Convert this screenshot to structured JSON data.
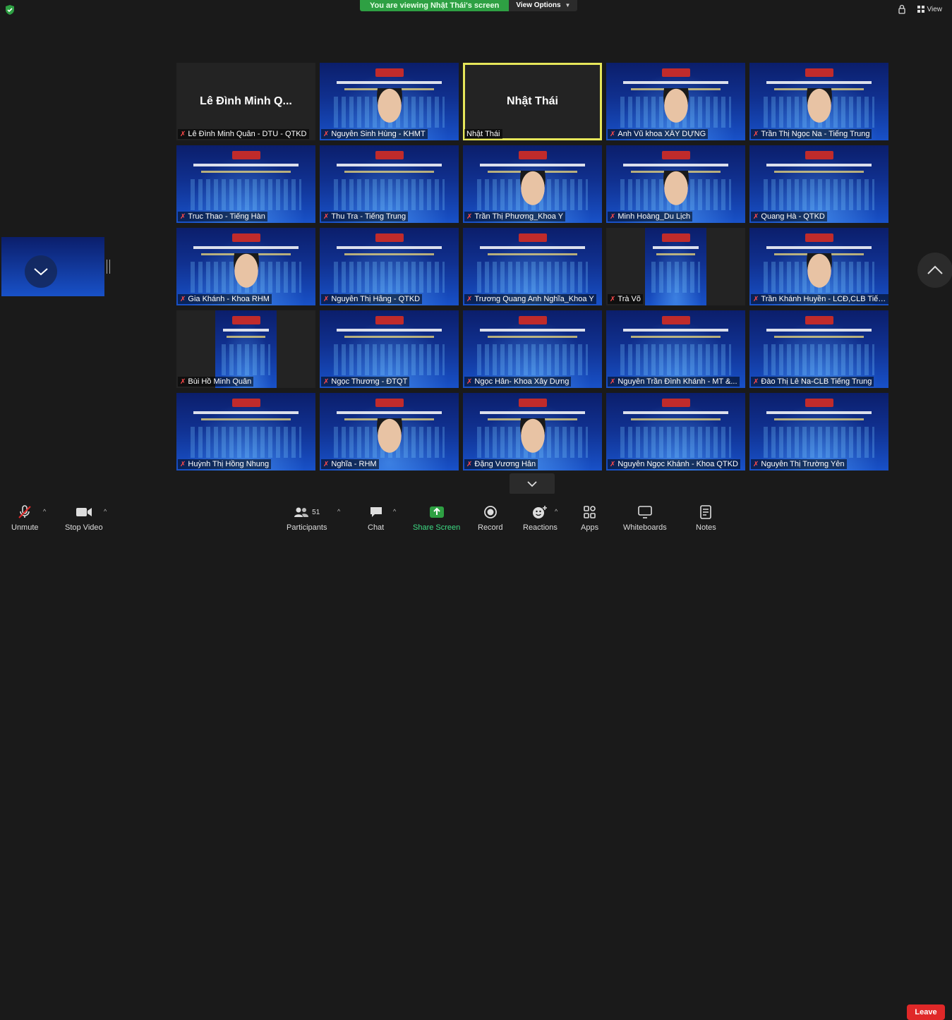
{
  "banner": {
    "viewing_text": "You are viewing Nhật Thái's screen",
    "view_options": "View Options"
  },
  "top_right": {
    "view_label": "View"
  },
  "tiles": [
    {
      "label": "Lê Đình Minh Quân - DTU - QTKD",
      "display_name": "Lê Đình Minh Q...",
      "type": "name"
    },
    {
      "label": "Nguyễn Sinh Hùng - KHMT",
      "type": "video-face"
    },
    {
      "label": "Nhật Thái",
      "display_name": "Nhật Thái",
      "type": "name",
      "active": true
    },
    {
      "label": "Anh Vũ khoa XÂY DỰNG",
      "type": "video-face"
    },
    {
      "label": "Trần Thị Ngọc Na - Tiếng Trung",
      "type": "video-face"
    },
    {
      "label": "Truc Thao - Tiếng Hàn",
      "type": "video"
    },
    {
      "label": "Thu Tra - Tiếng Trung",
      "type": "video"
    },
    {
      "label": "Trần Thị Phương_Khoa Y",
      "type": "video-face"
    },
    {
      "label": "Minh Hoàng_Du Lịch",
      "type": "video-face"
    },
    {
      "label": "Quang Hà - QTKD",
      "type": "video"
    },
    {
      "label": "Gia Khánh - Khoa RHM",
      "type": "video-face"
    },
    {
      "label": "Nguyễn Thị Hằng - QTKD",
      "type": "video"
    },
    {
      "label": "Trương Quang Anh Nghĩa_Khoa Y",
      "type": "video"
    },
    {
      "label": "Trà Võ",
      "type": "video-narrow"
    },
    {
      "label": "Trần Khánh Huyền - LCĐ,CLB Tiến...",
      "type": "video-face"
    },
    {
      "label": "Bùi Hồ Minh Quân",
      "type": "video-narrow"
    },
    {
      "label": "Ngọc Thương - ĐTQT",
      "type": "video"
    },
    {
      "label": "Ngọc Hân- Khoa Xây Dựng",
      "type": "video"
    },
    {
      "label": "Nguyễn Trần Đình Khánh - MT &...",
      "type": "video"
    },
    {
      "label": "Đào Thị Lê Na-CLB Tiếng Trung",
      "type": "video"
    },
    {
      "label": "Huỳnh Thị Hồng Nhung",
      "type": "video"
    },
    {
      "label": "Nghĩa - RHM",
      "type": "video-face"
    },
    {
      "label": "Đặng Vương Hân",
      "type": "video-face"
    },
    {
      "label": "Nguyễn Ngọc Khánh - Khoa QTKD",
      "type": "video"
    },
    {
      "label": "Nguyễn Thị Trường Yên",
      "type": "video"
    }
  ],
  "toolbar": {
    "unmute": "Unmute",
    "stop_video": "Stop Video",
    "participants": "Participants",
    "participants_count": "51",
    "chat": "Chat",
    "share_screen": "Share Screen",
    "record": "Record",
    "reactions": "Reactions",
    "apps": "Apps",
    "whiteboards": "Whiteboards",
    "notes": "Notes",
    "leave": "Leave"
  },
  "colors": {
    "share_green": "#3ddc84",
    "leave_red": "#e02828",
    "active_border": "#e6e65a",
    "banner_green": "#2ea043"
  }
}
